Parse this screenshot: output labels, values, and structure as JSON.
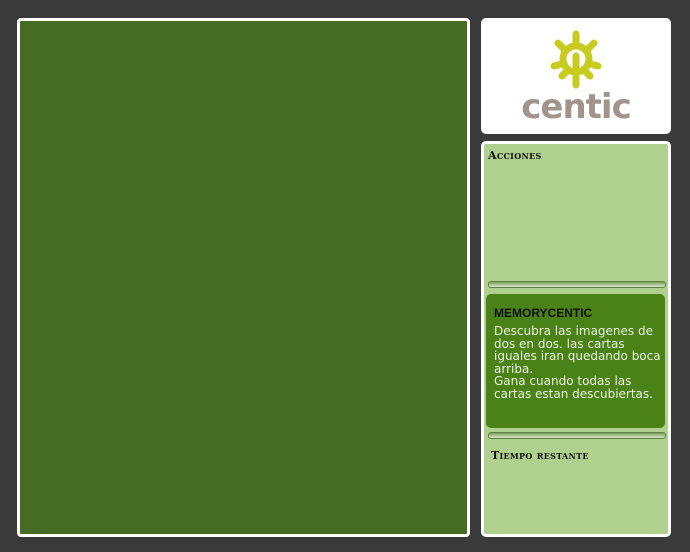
{
  "logo": {
    "text": "centic",
    "mark": "sun-gear-icon"
  },
  "panels": {
    "actions_title": "Acciones",
    "time_title": "Tiempo restante"
  },
  "info": {
    "title": "MEMORYCENTIC",
    "lines": [
      "Descubra las imagenes de dos en dos. las cartas iguales iran quedando boca arriba.",
      "Gana cuando todas las cartas estan descubiertas."
    ]
  },
  "colors": {
    "board": "#466b22",
    "side_panel": "#afd08f",
    "info_box": "#4a8218",
    "logo_mark": "#c8cc1e",
    "logo_text": "#a0948c",
    "background": "#3a3a3a"
  }
}
